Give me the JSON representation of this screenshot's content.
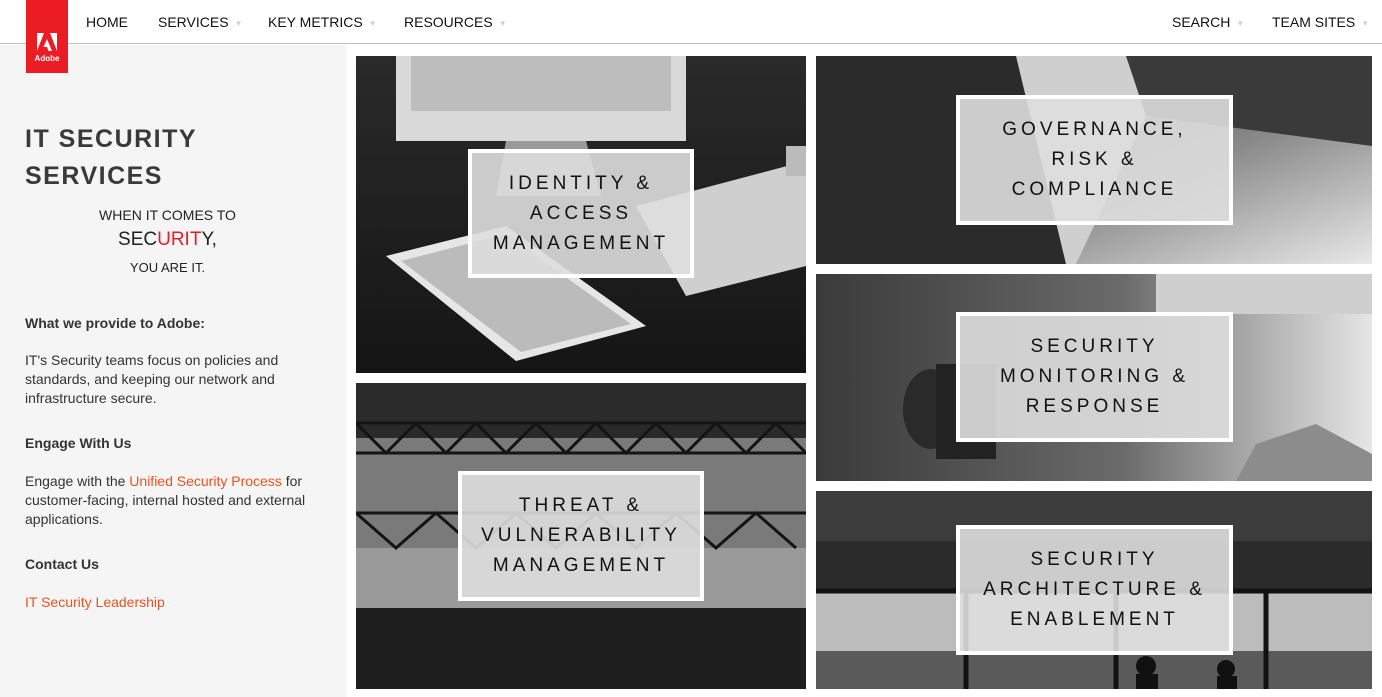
{
  "logo": {
    "text": "Adobe",
    "brand_color": "#ec1c24"
  },
  "nav": {
    "left": [
      {
        "label": "HOME"
      },
      {
        "label": "SERVICES"
      },
      {
        "label": "KEY METRICS"
      },
      {
        "label": "RESOURCES"
      }
    ],
    "right": [
      {
        "label": "SEARCH"
      },
      {
        "label": "TEAM SITES"
      }
    ]
  },
  "sidebar": {
    "title_line1": "IT SECURITY",
    "title_line2": "SERVICES",
    "tagline": {
      "line1": "WHEN IT COMES TO",
      "sec": "SEC",
      "urit": "URIT",
      "y": "Y,",
      "line3": "YOU ARE IT."
    },
    "provide_heading": "What we provide to Adobe:",
    "provide_text": "IT's Security teams focus on policies and standards, and keeping our network and infrastructure secure.",
    "engage_heading": "Engage With Us",
    "engage_before": "Engage with the ",
    "engage_link": "Unified Security Process",
    "engage_after": " for customer-facing, internal hosted and external applications.",
    "contact_heading": "Contact Us",
    "contact_link": "IT Security Leadership",
    "link_color": "#e8541e"
  },
  "tiles": [
    {
      "lines": [
        "IDENTITY &",
        "ACCESS",
        "MANAGEMENT"
      ]
    },
    {
      "lines": [
        "GOVERNANCE,",
        "RISK &",
        "COMPLIANCE"
      ]
    },
    {
      "lines": [
        "SECURITY",
        "MONITORING &",
        "RESPONSE"
      ]
    },
    {
      "lines": [
        "THREAT &",
        "VULNERABILITY",
        "MANAGEMENT"
      ]
    },
    {
      "lines": [
        "SECURITY",
        "ARCHITECTURE &",
        "ENABLEMENT"
      ]
    }
  ]
}
